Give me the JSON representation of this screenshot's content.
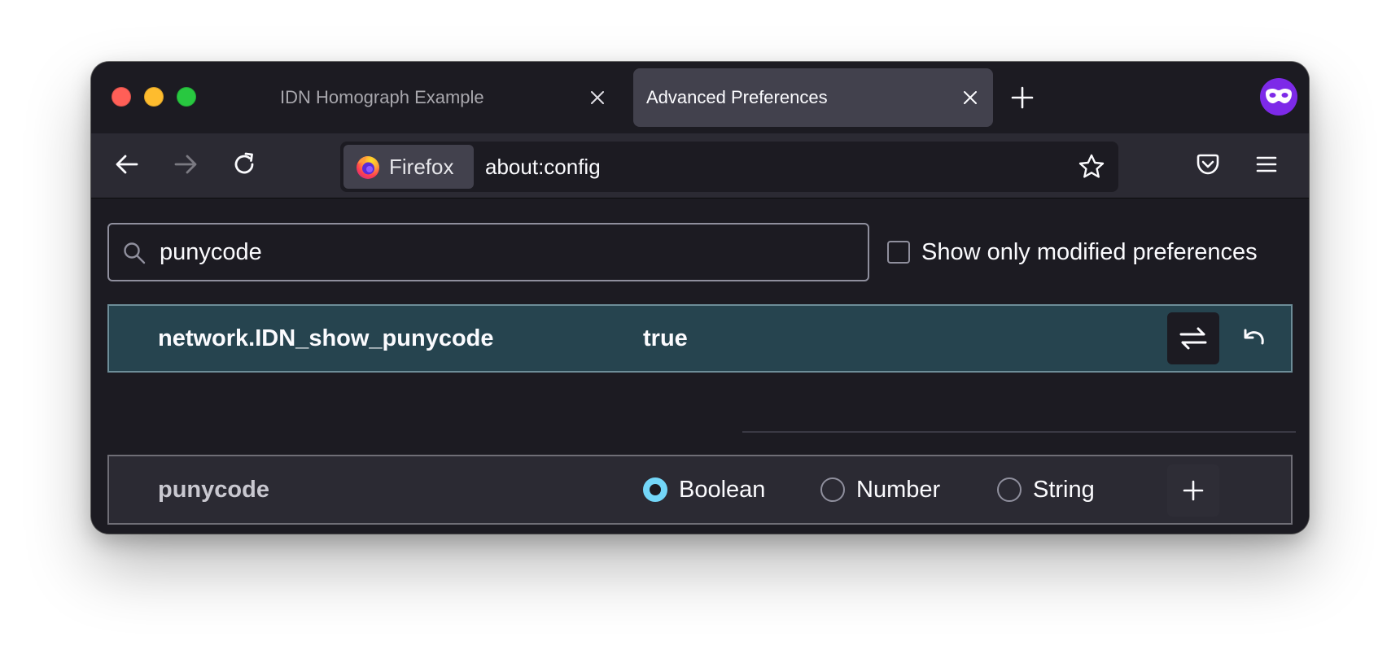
{
  "tabs": [
    {
      "title": "IDN Homograph Example",
      "active": false
    },
    {
      "title": "Advanced Preferences",
      "active": true
    }
  ],
  "toolbar": {
    "identity_label": "Firefox",
    "url": "about:config"
  },
  "search": {
    "value": "punycode"
  },
  "filter": {
    "label": "Show only modified preferences",
    "checked": false
  },
  "preferences": [
    {
      "name": "network.IDN_show_punycode",
      "value": "true",
      "modified": true
    }
  ],
  "new_preference": {
    "name": "punycode",
    "types": [
      "Boolean",
      "Number",
      "String"
    ],
    "selected": "Boolean"
  },
  "colors": {
    "accent": "#73d6f8",
    "modified_row": "#26444f",
    "private_badge": "#7d2ae8"
  },
  "icons": {
    "back": "arrow-left-icon",
    "forward": "arrow-right-icon",
    "reload": "reload-icon",
    "bookmark": "star-icon",
    "pocket": "pocket-icon",
    "menu": "hamburger-icon",
    "toggle": "swap-arrows-icon",
    "reset": "undo-icon",
    "add": "plus-icon",
    "private": "private-mask-icon"
  }
}
